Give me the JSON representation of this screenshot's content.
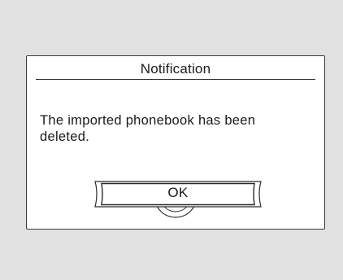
{
  "dialog": {
    "title": "Notification",
    "message": "The imported phonebook has been deleted.",
    "ok_label": "OK",
    "knob_icon": "dial-knob-icon"
  },
  "colors": {
    "background": "#e1e1e1",
    "dialog_fill": "#ffffff",
    "border": "#3a3a3a",
    "text": "#1a1a1a"
  }
}
